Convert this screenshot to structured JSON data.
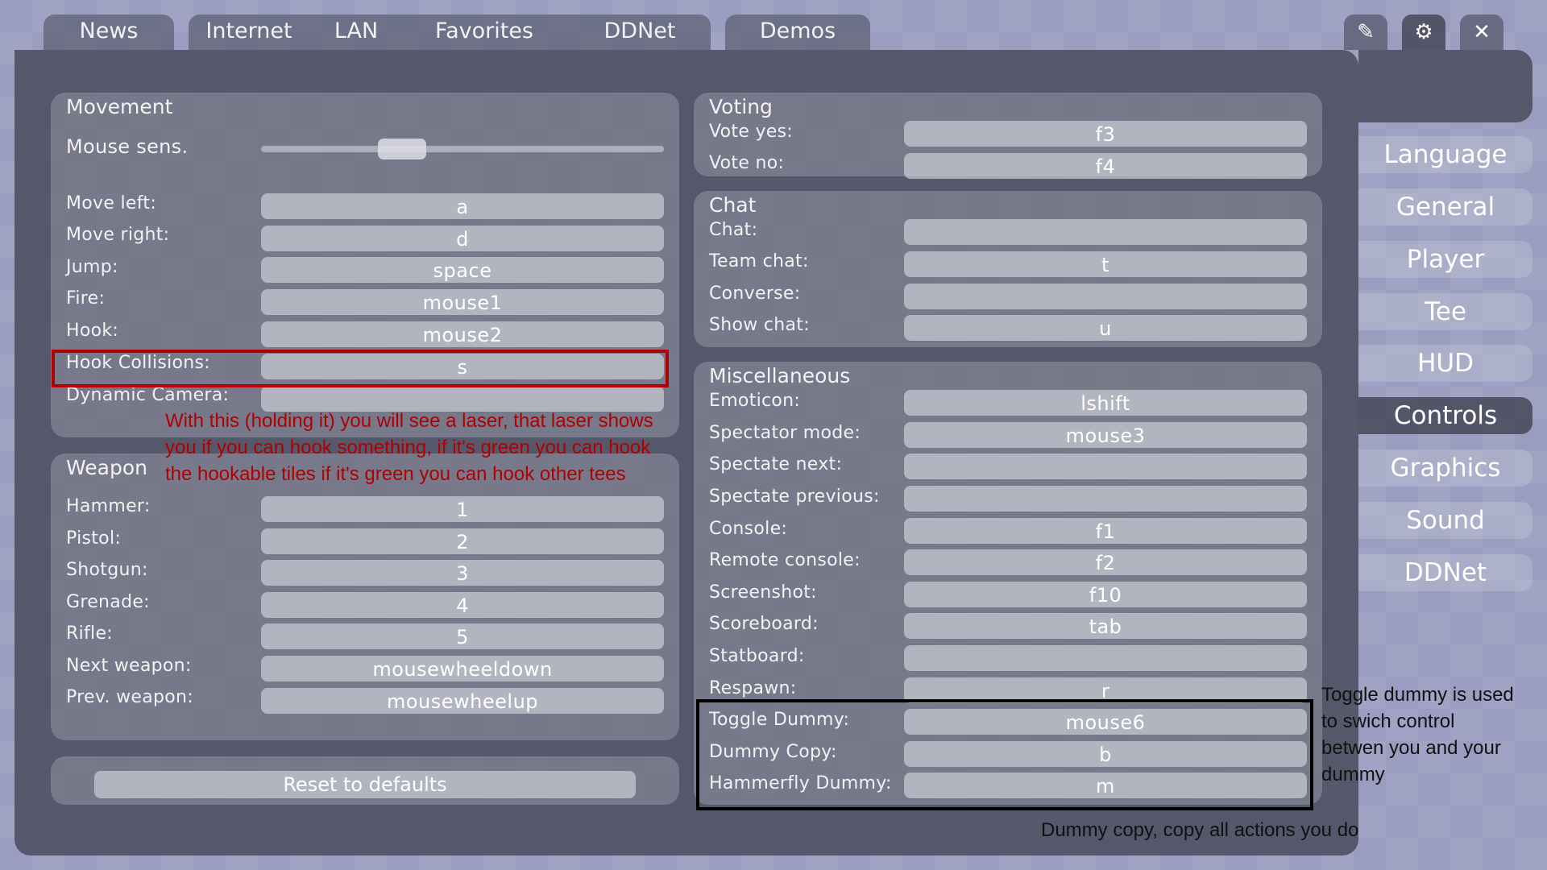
{
  "top_tabs": {
    "news": "News",
    "internet": "Internet",
    "lan": "LAN",
    "favorites": "Favorites",
    "ddnet": "DDNet",
    "demos": "Demos"
  },
  "top_icons": {
    "edit": "✎",
    "settings": "⚙",
    "close": "✕"
  },
  "sidebar": {
    "language": "Language",
    "general": "General",
    "player": "Player",
    "tee": "Tee",
    "hud": "HUD",
    "controls": "Controls",
    "graphics": "Graphics",
    "sound": "Sound",
    "ddnet": "DDNet",
    "active": "Controls"
  },
  "movement": {
    "title": "Movement",
    "mouse_sens_label": "Mouse sens.",
    "mouse_sens_fraction": 0.33,
    "move_left_label": "Move left:",
    "move_left_key": "a",
    "move_right_label": "Move right:",
    "move_right_key": "d",
    "jump_label": "Jump:",
    "jump_key": "space",
    "fire_label": "Fire:",
    "fire_key": "mouse1",
    "hook_label": "Hook:",
    "hook_key": "mouse2",
    "hook_collisions_label": "Hook Collisions:",
    "hook_collisions_key": "s",
    "dynamic_camera_label": "Dynamic Camera:",
    "dynamic_camera_key": ""
  },
  "weapon": {
    "title": "Weapon",
    "hammer_label": "Hammer:",
    "hammer_key": "1",
    "pistol_label": "Pistol:",
    "pistol_key": "2",
    "shotgun_label": "Shotgun:",
    "shotgun_key": "3",
    "grenade_label": "Grenade:",
    "grenade_key": "4",
    "rifle_label": "Rifle:",
    "rifle_key": "5",
    "next_weapon_label": "Next weapon:",
    "next_weapon_key": "mousewheeldown",
    "prev_weapon_label": "Prev. weapon:",
    "prev_weapon_key": "mousewheelup"
  },
  "reset_label": "Reset to defaults",
  "voting": {
    "title": "Voting",
    "vote_yes_label": "Vote yes:",
    "vote_yes_key": "f3",
    "vote_no_label": "Vote no:",
    "vote_no_key": "f4"
  },
  "chat": {
    "title": "Chat",
    "chat_label": "Chat:",
    "chat_key": "",
    "team_chat_label": "Team chat:",
    "team_chat_key": "t",
    "converse_label": "Converse:",
    "converse_key": "",
    "show_chat_label": "Show chat:",
    "show_chat_key": "u"
  },
  "misc": {
    "title": "Miscellaneous",
    "emoticon_label": "Emoticon:",
    "emoticon_key": "lshift",
    "spectator_mode_label": "Spectator mode:",
    "spectator_mode_key": "mouse3",
    "spectate_next_label": "Spectate next:",
    "spectate_next_key": "",
    "spectate_previous_label": "Spectate previous:",
    "spectate_previous_key": "",
    "console_label": "Console:",
    "console_key": "f1",
    "remote_console_label": "Remote console:",
    "remote_console_key": "f2",
    "screenshot_label": "Screenshot:",
    "screenshot_key": "f10",
    "scoreboard_label": "Scoreboard:",
    "scoreboard_key": "tab",
    "statboard_label": "Statboard:",
    "statboard_key": "",
    "respawn_label": "Respawn:",
    "respawn_key": "r",
    "toggle_dummy_label": "Toggle Dummy:",
    "toggle_dummy_key": "mouse6",
    "dummy_copy_label": "Dummy Copy:",
    "dummy_copy_key": "b",
    "hammerfly_dummy_label": "Hammerfly Dummy:",
    "hammerfly_dummy_key": "m"
  },
  "annotations": {
    "hook_note_line1": "With this (holding it) you will see a laser, that laser shows",
    "hook_note_line2": "you if you can hook something, if it's green you can hook",
    "hook_note_line3": "the hookable tiles if it's green you can hook other tees",
    "dummy_note_line1": "Toggle dummy is used",
    "dummy_note_line2": "to swich control",
    "dummy_note_line3": "betwen you and your",
    "dummy_note_line4": "dummy",
    "copy_note": "Dummy copy, copy all actions you do",
    "red_color": "#b00000",
    "black_color": "#000000"
  }
}
